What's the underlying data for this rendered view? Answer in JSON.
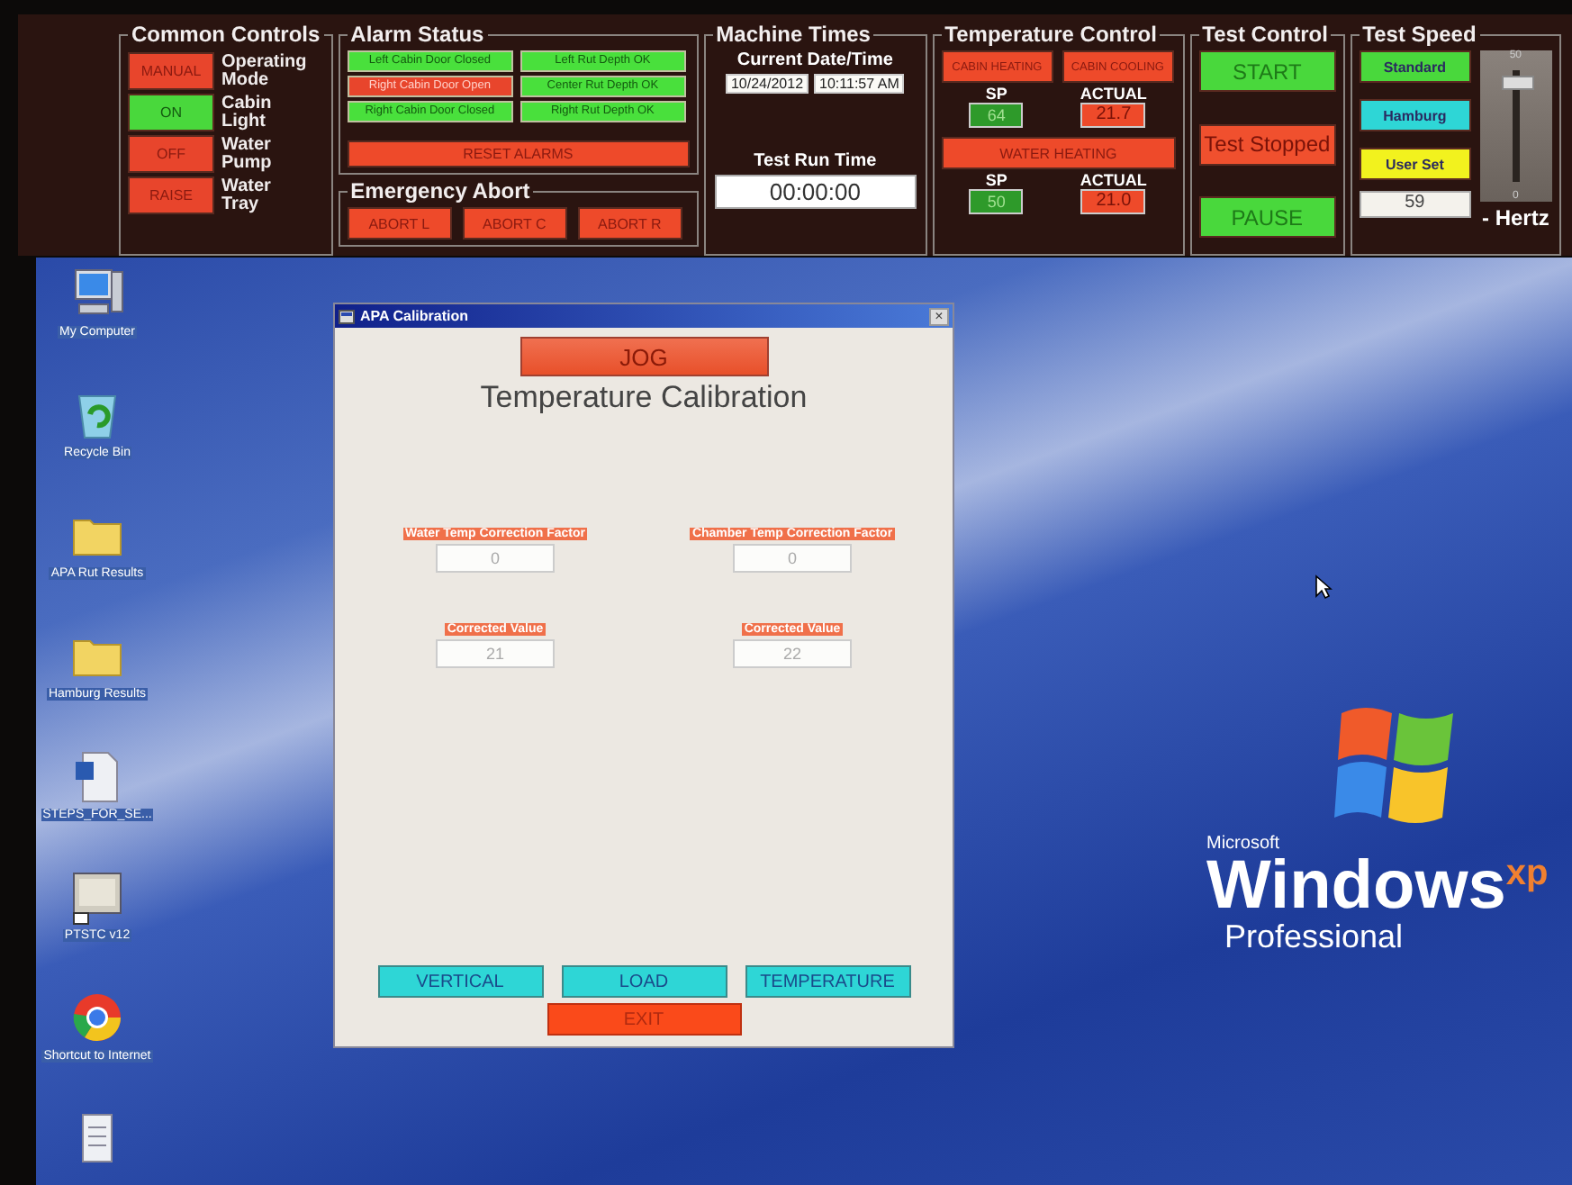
{
  "control_panel": {
    "common_controls": {
      "title": "Common Controls",
      "items": [
        {
          "button": "MANUAL",
          "color": "#e8452c",
          "label": "Operating Mode"
        },
        {
          "button": "ON",
          "color": "#49d83c",
          "label": "Cabin Light"
        },
        {
          "button": "OFF",
          "color": "#e8452c",
          "label": "Water Pump"
        },
        {
          "button": "RAISE",
          "color": "#e8452c",
          "label": "Water Tray"
        }
      ]
    },
    "alarm_status": {
      "title": "Alarm Status",
      "alarms": [
        {
          "text": "Left Cabin Door Closed",
          "color": "#49e03c"
        },
        {
          "text": "Left Rut Depth OK",
          "color": "#49e03c"
        },
        {
          "text": "Right Cabin Door Open",
          "color": "#e8452c"
        },
        {
          "text": "Center Rut Depth OK",
          "color": "#49e03c"
        },
        {
          "text": "Right Cabin Door Closed",
          "color": "#49e03c"
        },
        {
          "text": "Right Rut Depth OK",
          "color": "#49e03c"
        }
      ],
      "reset_button": "RESET ALARMS"
    },
    "emergency_abort": {
      "title": "Emergency Abort",
      "buttons": [
        "ABORT L",
        "ABORT C",
        "ABORT R"
      ]
    },
    "machine_times": {
      "title": "Machine Times",
      "date_label": "Current Date/Time",
      "date": "10/24/2012",
      "time": "10:11:57 AM",
      "run_label": "Test Run Time",
      "run_time": "00:00:00"
    },
    "temperature_control": {
      "title": "Temperature Control",
      "buttons": [
        "CABIN HEATING",
        "CABIN COOLING"
      ],
      "cabin": {
        "sp_label": "SP",
        "sp": "64",
        "actual_label": "ACTUAL",
        "actual": "21.7"
      },
      "water_button": "WATER HEATING",
      "water": {
        "sp_label": "SP",
        "sp": "50",
        "actual_label": "ACTUAL",
        "actual": "21.0"
      }
    },
    "test_control": {
      "title": "Test Control",
      "buttons": [
        {
          "label": "START",
          "color": "#49d83c"
        },
        {
          "label": "Test Stopped",
          "color": "#f0502e"
        },
        {
          "label": "PAUSE",
          "color": "#49d83c"
        }
      ]
    },
    "test_speed": {
      "title": "Test Speed",
      "presets": [
        {
          "label": "Standard",
          "color": "#49d83c"
        },
        {
          "label": "Hamburg",
          "color": "#2ed6d6"
        },
        {
          "label": "User Set",
          "color": "#f2f21e"
        }
      ],
      "value": "59",
      "unit": "- Hertz",
      "slider": {
        "level": 0.88,
        "max_label": "50",
        "min_label": "0"
      }
    }
  },
  "desktop": {
    "icons": [
      {
        "label": "My Computer",
        "kind": "computer"
      },
      {
        "label": "Recycle Bin",
        "kind": "recycle"
      },
      {
        "label": "APA Rut Results",
        "kind": "folder"
      },
      {
        "label": "Hamburg Results",
        "kind": "folder"
      },
      {
        "label": "STEPS_FOR_SE...",
        "kind": "document"
      },
      {
        "label": "PTSTC v12",
        "kind": "program"
      },
      {
        "label": "Shortcut to Internet",
        "kind": "browser"
      },
      {
        "kind": "notepad"
      }
    ],
    "logo": {
      "brand": "Microsoft",
      "name": "Windows",
      "mark": "xp",
      "edition": "Professional"
    }
  },
  "dialog": {
    "title": "APA Calibration",
    "close_button": "×",
    "jog_button": "JOG",
    "heading": "Temperature Calibration",
    "fields": [
      {
        "label": "Water Temp Correction Factor",
        "value": "0",
        "disabled": true
      },
      {
        "label": "Chamber Temp Correction Factor",
        "value": "0",
        "disabled": true
      },
      {
        "label": "Corrected Value",
        "value": "21",
        "disabled": true
      },
      {
        "label": "Corrected Value",
        "value": "22",
        "disabled": true
      }
    ],
    "buttons": [
      {
        "label": "VERTICAL",
        "kind": "nav"
      },
      {
        "label": "LOAD",
        "kind": "nav"
      },
      {
        "label": "TEMPERATURE",
        "kind": "nav"
      },
      {
        "label": "EXIT",
        "kind": "exit"
      }
    ]
  }
}
